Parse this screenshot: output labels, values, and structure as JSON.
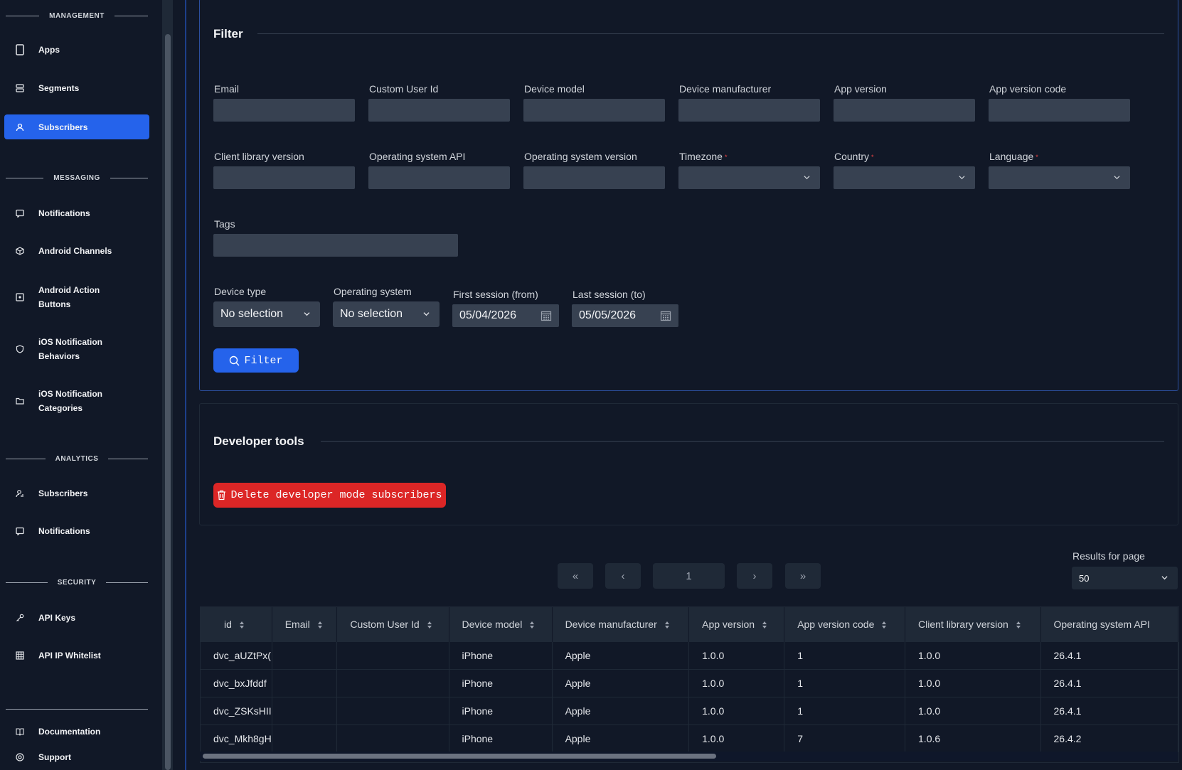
{
  "sidebar": {
    "sections": {
      "management": "MANAGEMENT",
      "messaging": "MESSAGING",
      "analytics": "ANALYTICS",
      "security": "SECURITY"
    },
    "items": {
      "apps": "Apps",
      "segments": "Segments",
      "subscribers": "Subscribers",
      "notifications": "Notifications",
      "android_channels": "Android Channels",
      "android_action_buttons_1": "Android Action",
      "android_action_buttons_2": "Buttons",
      "ios_notification_behaviors_1": "iOS Notification",
      "ios_notification_behaviors_2": "Behaviors",
      "ios_notification_categories_1": "iOS Notification",
      "ios_notification_categories_2": "Categories",
      "analytics_subscribers": "Subscribers",
      "analytics_notifications": "Notifications",
      "api_keys": "API Keys",
      "api_ip_whitelist": "API IP Whitelist",
      "documentation": "Documentation",
      "support": "Support"
    },
    "active_item": "subscribers"
  },
  "filter": {
    "title": "Filter",
    "labels": {
      "email": "Email",
      "custom_user_id": "Custom User Id",
      "device_model": "Device model",
      "device_manufacturer": "Device manufacturer",
      "app_version": "App version",
      "app_version_code": "App version code",
      "client_library_version": "Client library version",
      "operating_system_api": "Operating system API",
      "operating_system_version": "Operating system version",
      "timezone": "Timezone",
      "country": "Country",
      "language": "Language",
      "tags": "Tags",
      "device_type": "Device type",
      "operating_system": "Operating system",
      "first_session": "First session (from)",
      "last_session": "Last session (to)"
    },
    "values": {
      "device_type": "No selection",
      "operating_system": "No selection",
      "first_session": "05/04/2026",
      "last_session": "05/05/2026"
    },
    "required_mark": "*",
    "button_label": "Filter"
  },
  "developer_tools": {
    "title": "Developer tools",
    "delete_label": "Delete developer mode subscribers"
  },
  "pagination": {
    "first": "«",
    "prev": "‹",
    "current_page": "1",
    "next": "›",
    "last": "»",
    "results_label": "Results for page",
    "results_value": "50"
  },
  "table": {
    "columns": [
      "id",
      "Email",
      "Custom User Id",
      "Device model",
      "Device manufacturer",
      "App version",
      "App version code",
      "Client library version",
      "Operating system API"
    ],
    "rows": [
      [
        "dvc_aUZtPx(",
        "",
        "",
        "iPhone",
        "Apple",
        "1.0.0",
        "1",
        "1.0.0",
        "26.4.1"
      ],
      [
        "dvc_bxJfddf",
        "",
        "",
        "iPhone",
        "Apple",
        "1.0.0",
        "1",
        "1.0.0",
        "26.4.1"
      ],
      [
        "dvc_ZSKsHII",
        "",
        "",
        "iPhone",
        "Apple",
        "1.0.0",
        "1",
        "1.0.0",
        "26.4.1"
      ],
      [
        "dvc_Mkh8gH",
        "",
        "",
        "iPhone",
        "Apple",
        "1.0.0",
        "7",
        "1.0.6",
        "26.4.2"
      ]
    ]
  },
  "colors": {
    "accent": "#2563eb",
    "danger": "#dc2626",
    "background": "#111827",
    "input": "#374151"
  }
}
